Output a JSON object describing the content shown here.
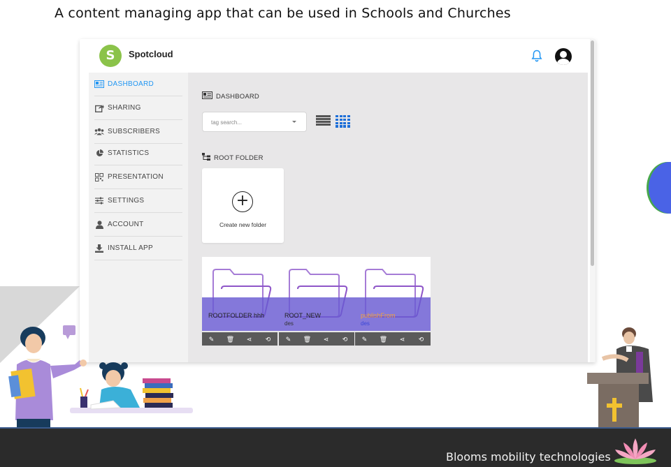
{
  "headline": "A content managing app that can be used in Schools and Churches",
  "app": {
    "brand": "Spotcloud",
    "logo_letter": "S",
    "sidebar": [
      {
        "label": "DASHBOARD",
        "icon": "dashboard-icon",
        "active": true
      },
      {
        "label": "SHARING",
        "icon": "share-box-icon"
      },
      {
        "label": "SUBSCRIBERS",
        "icon": "users-icon"
      },
      {
        "label": "STATISTICS",
        "icon": "pie-chart-icon"
      },
      {
        "label": "PRESENTATION",
        "icon": "qr-icon"
      },
      {
        "label": "SETTINGS",
        "icon": "sliders-icon"
      },
      {
        "label": "ACCOUNT",
        "icon": "user-icon"
      },
      {
        "label": "INSTALL APP",
        "icon": "download-icon"
      }
    ],
    "main": {
      "title": "DASHBOARD",
      "search_placeholder": "tag search...",
      "root_title": "ROOT FOLDER",
      "create_label": "Create new folder",
      "folders": [
        {
          "name": "ROOTFOLDER hhh",
          "desc": ""
        },
        {
          "name": "ROOT_NEW",
          "desc": "des"
        },
        {
          "name": "publishFrom",
          "desc": "des"
        }
      ]
    },
    "accent": "#2196f3"
  },
  "footer": "Blooms mobility technologies"
}
